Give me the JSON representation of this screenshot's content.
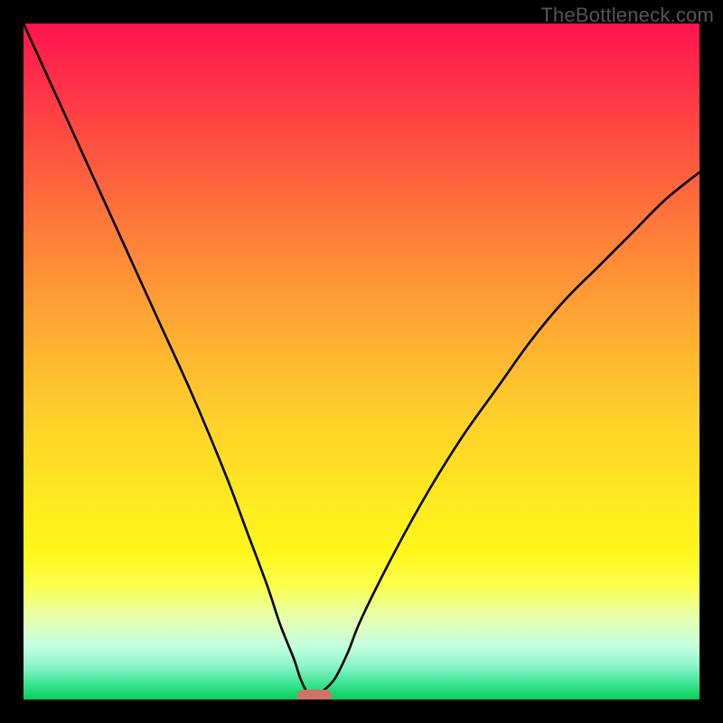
{
  "watermark": "TheBottleneck.com",
  "chart_data": {
    "type": "line",
    "title": "",
    "xlabel": "",
    "ylabel": "",
    "xlim": [
      0,
      100
    ],
    "ylim": [
      0,
      100
    ],
    "legend": false,
    "grid": false,
    "background": "gradient-red-yellow-green",
    "series": [
      {
        "name": "bottleneck-curve",
        "x": [
          0,
          5,
          10,
          15,
          20,
          25,
          30,
          33,
          36,
          38,
          40,
          41,
          42,
          43,
          44,
          46,
          48,
          50,
          55,
          60,
          65,
          70,
          75,
          80,
          85,
          90,
          95,
          100
        ],
        "y": [
          100,
          89,
          78,
          67,
          56,
          45,
          33,
          25,
          17,
          11,
          6,
          3,
          1,
          0,
          1,
          3,
          7,
          12,
          22,
          31,
          39,
          46,
          53,
          59,
          64,
          69,
          74,
          78
        ]
      }
    ],
    "annotations": [
      {
        "name": "optimal-marker",
        "shape": "rounded-rect",
        "x": 43,
        "y": 0,
        "color": "#cf7267"
      }
    ]
  }
}
